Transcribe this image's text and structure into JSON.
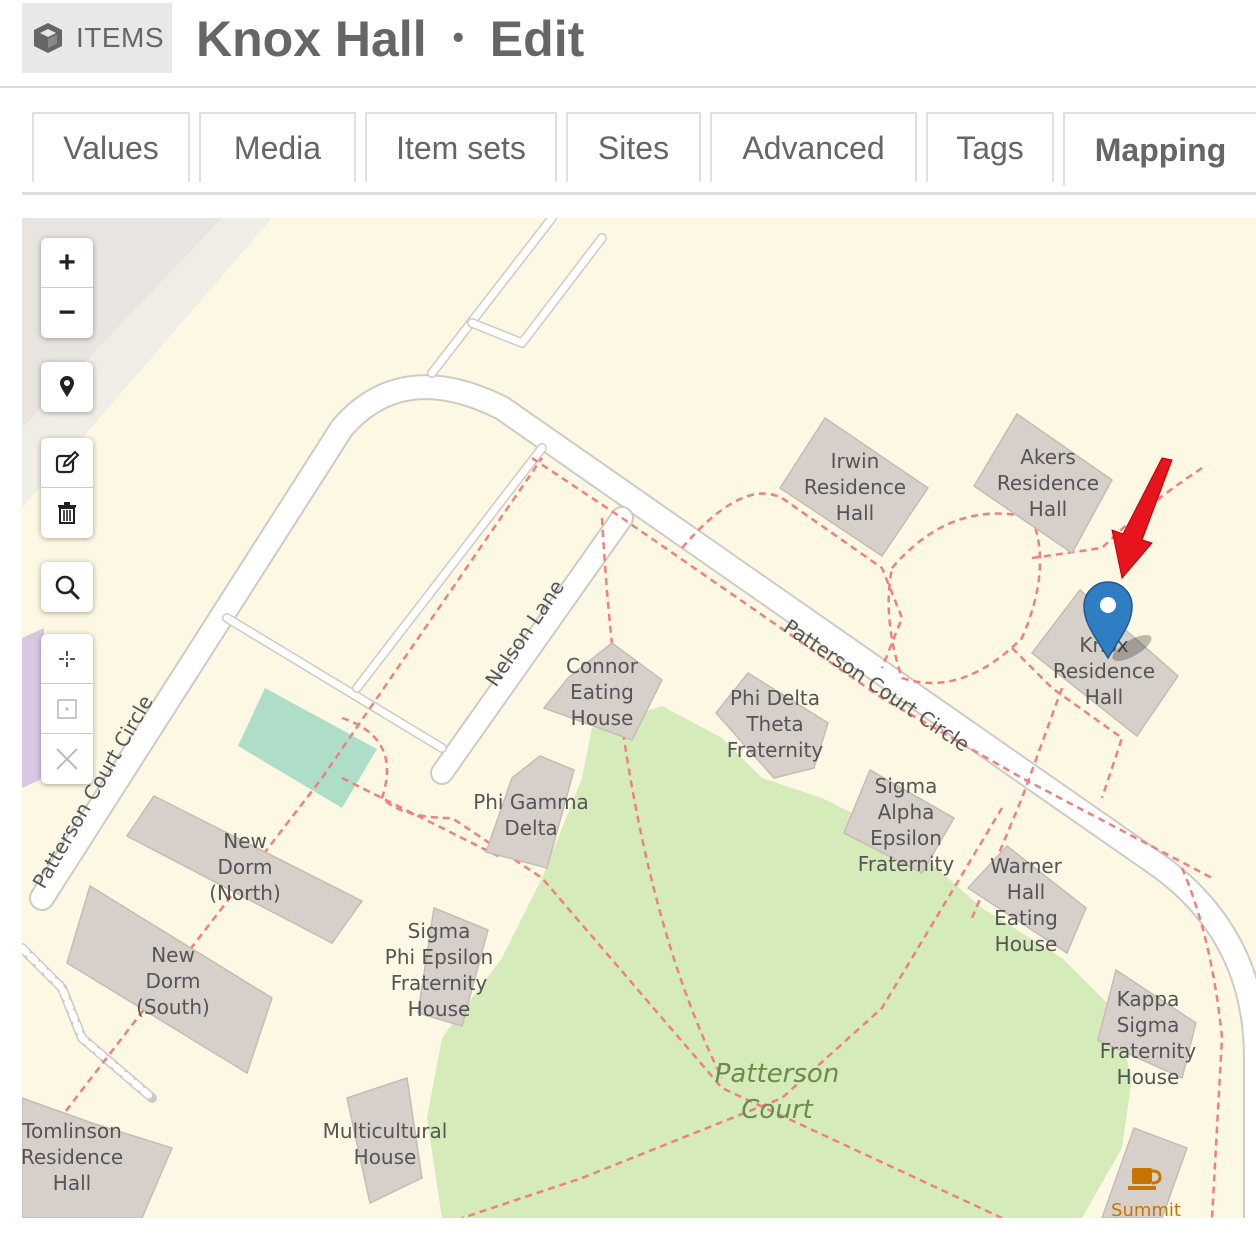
{
  "header": {
    "section_label": "ITEMS",
    "item_title": "Knox Hall",
    "separator": "•",
    "mode": "Edit"
  },
  "tabs": [
    {
      "label": "Values",
      "active": false
    },
    {
      "label": "Media",
      "active": false
    },
    {
      "label": "Item sets",
      "active": false
    },
    {
      "label": "Sites",
      "active": false
    },
    {
      "label": "Advanced",
      "active": false
    },
    {
      "label": "Tags",
      "active": false
    },
    {
      "label": "Mapping",
      "active": true
    }
  ],
  "map": {
    "controls": {
      "zoom_in": "+",
      "zoom_out": "−",
      "locate_icon": "map-marker-icon",
      "edit_icon": "edit-icon",
      "delete_icon": "trash-icon",
      "search_icon": "search-icon",
      "set_default_icon": "crosshair-icon",
      "view_default_icon": "square-dot-icon",
      "clear_default_icon": "close-icon"
    },
    "labels": {
      "patterson_circle_top": "Patterson Court Circle",
      "patterson_circle_left": "Patterson Court Circle",
      "nelson_lane": "Nelson Lane",
      "irwin": [
        "Irwin",
        "Residence",
        "Hall"
      ],
      "akers": [
        "Akers",
        "Residence",
        "Hall"
      ],
      "knox": [
        "Knox",
        "Residence",
        "Hall"
      ],
      "connor": [
        "Connor",
        "Eating",
        "House"
      ],
      "phi_delta": [
        "Phi Delta",
        "Theta",
        "Fraternity"
      ],
      "sigma_alpha": [
        "Sigma",
        "Alpha",
        "Epsilon",
        "Fraternity"
      ],
      "phi_gamma": [
        "Phi Gamma",
        "Delta"
      ],
      "new_dorm_north": [
        "New",
        "Dorm",
        "(North)"
      ],
      "new_dorm_south": [
        "New",
        "Dorm",
        "(South)"
      ],
      "sigma_phi": [
        "Sigma",
        "Phi Epsilon",
        "Fraternity",
        "House"
      ],
      "warner": [
        "Warner",
        "Hall",
        "Eating",
        "House"
      ],
      "kappa": [
        "Kappa",
        "Sigma",
        "Fraternity",
        "House"
      ],
      "patterson_court": [
        "Patterson",
        "Court"
      ],
      "tomlinson": [
        "Tomlinson",
        "Residence",
        "Hall"
      ],
      "multicultural": [
        "Multicultural",
        "House"
      ],
      "summit": "Summit"
    },
    "colors": {
      "land": "#fcf8e3",
      "park": "#d5ebba",
      "building": "#d7d0ca",
      "road": "#ffffff",
      "path": "#f08080",
      "pin": "#2f7dc2",
      "arrow": "#e8141d"
    }
  }
}
